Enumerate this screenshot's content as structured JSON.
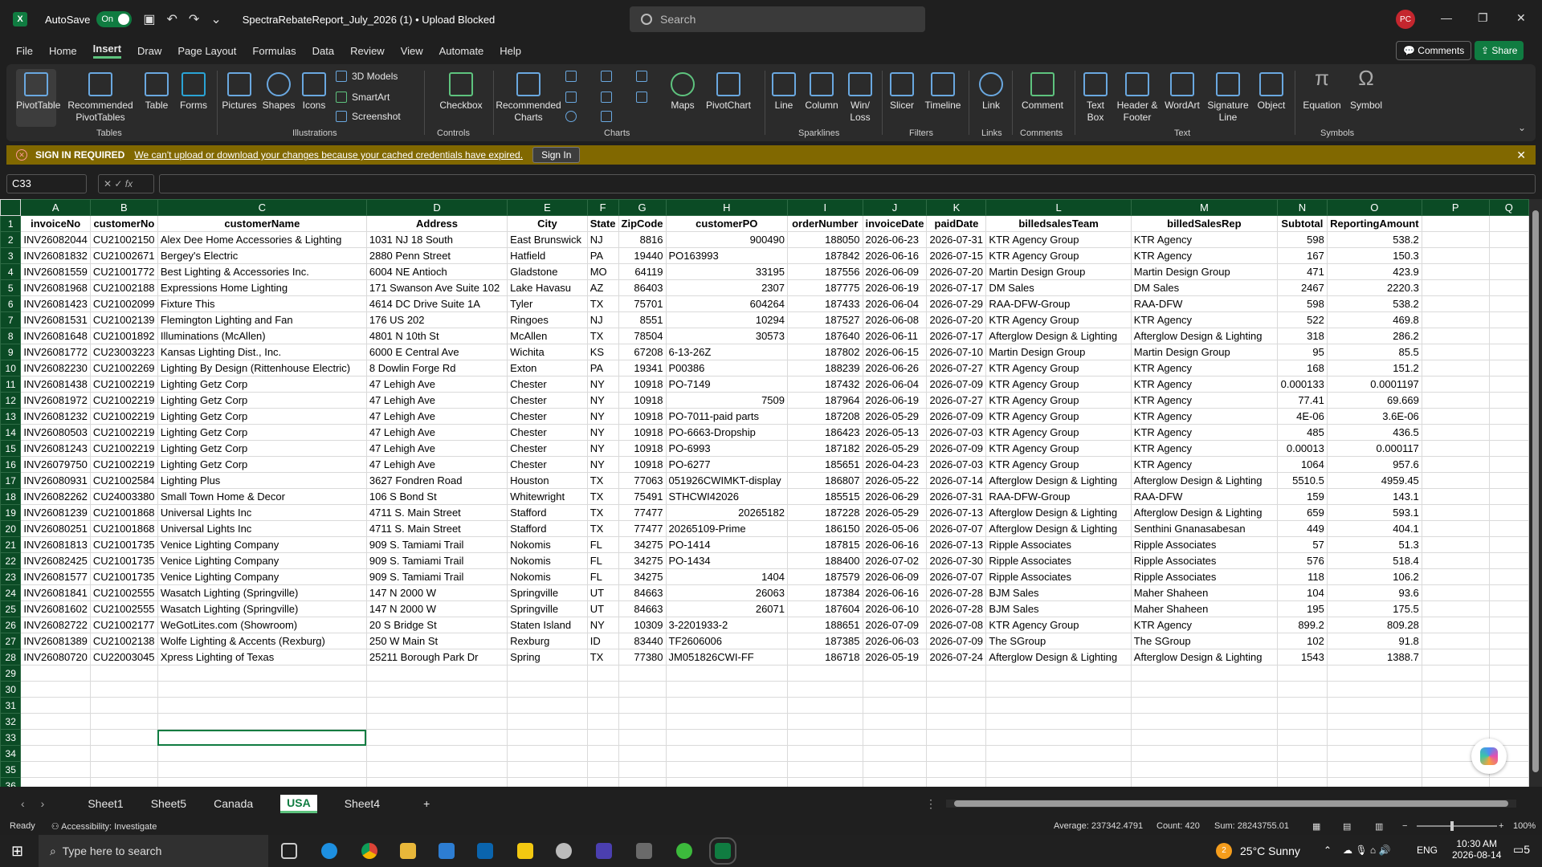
{
  "titlebar": {
    "autosave_label": "AutoSave",
    "autosave_state": "On",
    "doc_title": "SpectraRebateReport_July_2026 (1) • Upload Blocked",
    "search_placeholder": "Search",
    "avatar_initials": "PC"
  },
  "menu": {
    "items": [
      "File",
      "Home",
      "Insert",
      "Draw",
      "Page Layout",
      "Formulas",
      "Data",
      "Review",
      "View",
      "Automate",
      "Help"
    ],
    "active": "Insert",
    "comments_label": "Comments",
    "share_label": "Share"
  },
  "ribbon": {
    "pivottable": "PivotTable",
    "recommended_pivottables": "Recommended PivotTables",
    "table": "Table",
    "forms": "Forms",
    "pictures": "Pictures",
    "shapes": "Shapes",
    "icons": "Icons",
    "models3d": "3D Models",
    "smartart": "SmartArt",
    "screenshot": "Screenshot",
    "checkbox": "Checkbox",
    "recommended_charts": "Recommended Charts",
    "maps": "Maps",
    "pivotchart": "PivotChart",
    "line": "Line",
    "column": "Column",
    "winloss": "Win/ Loss",
    "slicer": "Slicer",
    "timeline": "Timeline",
    "link": "Link",
    "comment": "Comment",
    "textbox": "Text Box",
    "header_footer": "Header & Footer",
    "wordart": "WordArt",
    "signature_line": "Signature Line",
    "object": "Object",
    "equation": "Equation",
    "symbol": "Symbol",
    "groups": {
      "tables": "Tables",
      "illustrations": "Illustrations",
      "controls": "Controls",
      "charts": "Charts",
      "sparklines": "Sparklines",
      "filters": "Filters",
      "links": "Links",
      "comments": "Comments",
      "text": "Text",
      "symbols": "Symbols"
    }
  },
  "infobar": {
    "title": "SIGN IN REQUIRED",
    "message": "We can't upload or download your changes because your cached credentials have expired.",
    "button": "Sign In"
  },
  "formula_bar": {
    "name_box": "C33",
    "fx": "fx",
    "value": ""
  },
  "grid": {
    "columns": [
      "A",
      "B",
      "C",
      "D",
      "E",
      "F",
      "G",
      "H",
      "I",
      "J",
      "K",
      "L",
      "M",
      "N",
      "O",
      "P",
      "Q"
    ],
    "headers": [
      "invoiceNo",
      "customerNo",
      "customerName",
      "Address",
      "City",
      "State",
      "ZipCode",
      "customerPO",
      "orderNumber",
      "invoiceDate",
      "paidDate",
      "billedsalesTeam",
      "billedSalesRep",
      "Subtotal",
      "ReportingAmount",
      "",
      ""
    ],
    "rows": [
      [
        "INV26082044",
        "CU21002150",
        "Alex Dee Home Accessories & Lighting",
        "1031 NJ 18 South",
        "East Brunswick",
        "NJ",
        "8816",
        "900490",
        "188050",
        "2026-06-23",
        "2026-07-31",
        "KTR Agency Group",
        "KTR Agency",
        "598",
        "538.2"
      ],
      [
        "INV26081832",
        "CU21002671",
        "Bergey's Electric",
        "2880 Penn Street",
        "Hatfield",
        "PA",
        "19440",
        "PO163993",
        "187842",
        "2026-06-16",
        "2026-07-15",
        "KTR Agency Group",
        "KTR Agency",
        "167",
        "150.3"
      ],
      [
        "INV26081559",
        "CU21001772",
        "Best Lighting & Accessories Inc.",
        "6004 NE Antioch",
        "Gladstone",
        "MO",
        "64119",
        "33195",
        "187556",
        "2026-06-09",
        "2026-07-20",
        "Martin Design Group",
        "Martin Design Group",
        "471",
        "423.9"
      ],
      [
        "INV26081968",
        "CU21002188",
        "Expressions Home Lighting",
        "171 Swanson Ave Suite 102",
        "Lake Havasu",
        "AZ",
        "86403",
        "2307",
        "187775",
        "2026-06-19",
        "2026-07-17",
        "DM Sales",
        "DM Sales",
        "2467",
        "2220.3"
      ],
      [
        "INV26081423",
        "CU21002099",
        "Fixture This",
        "4614 DC Drive Suite 1A",
        "Tyler",
        "TX",
        "75701",
        "604264",
        "187433",
        "2026-06-04",
        "2026-07-29",
        "RAA-DFW-Group",
        "RAA-DFW",
        "598",
        "538.2"
      ],
      [
        "INV26081531",
        "CU21002139",
        "Flemington Lighting and Fan",
        "176 US 202",
        "Ringoes",
        "NJ",
        "8551",
        "10294",
        "187527",
        "2026-06-08",
        "2026-07-20",
        "KTR Agency Group",
        "KTR Agency",
        "522",
        "469.8"
      ],
      [
        "INV26081648",
        "CU21001892",
        "Illuminations (McAllen)",
        "4801 N 10th St",
        "McAllen",
        "TX",
        "78504",
        "30573",
        "187640",
        "2026-06-11",
        "2026-07-17",
        "Afterglow Design & Lighting",
        "Afterglow Design & Lighting",
        "318",
        "286.2"
      ],
      [
        "INV26081772",
        "CU23003223",
        "Kansas Lighting Dist., Inc.",
        "6000 E Central Ave",
        "Wichita",
        "KS",
        "67208",
        "6-13-26Z",
        "187802",
        "2026-06-15",
        "2026-07-10",
        "Martin Design Group",
        "Martin Design Group",
        "95",
        "85.5"
      ],
      [
        "INV26082230",
        "CU21002269",
        "Lighting By Design (Rittenhouse Electric)",
        "8 Dowlin Forge Rd",
        "Exton",
        "PA",
        "19341",
        "P00386",
        "188239",
        "2026-06-26",
        "2026-07-27",
        "KTR Agency Group",
        "KTR Agency",
        "168",
        "151.2"
      ],
      [
        "INV26081438",
        "CU21002219",
        "Lighting Getz Corp",
        "47 Lehigh Ave",
        "Chester",
        "NY",
        "10918",
        "PO-7149",
        "187432",
        "2026-06-04",
        "2026-07-09",
        "KTR Agency Group",
        "KTR Agency",
        "0.000133",
        "0.0001197"
      ],
      [
        "INV26081972",
        "CU21002219",
        "Lighting Getz Corp",
        "47 Lehigh Ave",
        "Chester",
        "NY",
        "10918",
        "7509",
        "187964",
        "2026-06-19",
        "2026-07-27",
        "KTR Agency Group",
        "KTR Agency",
        "77.41",
        "69.669"
      ],
      [
        "INV26081232",
        "CU21002219",
        "Lighting Getz Corp",
        "47 Lehigh Ave",
        "Chester",
        "NY",
        "10918",
        "PO-7011-paid parts",
        "187208",
        "2026-05-29",
        "2026-07-09",
        "KTR Agency Group",
        "KTR Agency",
        "4E-06",
        "3.6E-06"
      ],
      [
        "INV26080503",
        "CU21002219",
        "Lighting Getz Corp",
        "47 Lehigh Ave",
        "Chester",
        "NY",
        "10918",
        "PO-6663-Dropship",
        "186423",
        "2026-05-13",
        "2026-07-03",
        "KTR Agency Group",
        "KTR Agency",
        "485",
        "436.5"
      ],
      [
        "INV26081243",
        "CU21002219",
        "Lighting Getz Corp",
        "47 Lehigh Ave",
        "Chester",
        "NY",
        "10918",
        "PO-6993",
        "187182",
        "2026-05-29",
        "2026-07-09",
        "KTR Agency Group",
        "KTR Agency",
        "0.00013",
        "0.000117"
      ],
      [
        "INV26079750",
        "CU21002219",
        "Lighting Getz Corp",
        "47 Lehigh Ave",
        "Chester",
        "NY",
        "10918",
        "PO-6277",
        "185651",
        "2026-04-23",
        "2026-07-03",
        "KTR Agency Group",
        "KTR Agency",
        "1064",
        "957.6"
      ],
      [
        "INV26080931",
        "CU21002584",
        "Lighting Plus",
        "3627 Fondren Road",
        "Houston",
        "TX",
        "77063",
        "051926CWIMKT-display",
        "186807",
        "2026-05-22",
        "2026-07-14",
        "Afterglow Design & Lighting",
        "Afterglow Design & Lighting",
        "5510.5",
        "4959.45"
      ],
      [
        "INV26082262",
        "CU24003380",
        "Small Town Home & Decor",
        "106 S Bond St",
        "Whitewright",
        "TX",
        "75491",
        "STHCWI42026",
        "185515",
        "2026-06-29",
        "2026-07-31",
        "RAA-DFW-Group",
        "RAA-DFW",
        "159",
        "143.1"
      ],
      [
        "INV26081239",
        "CU21001868",
        "Universal Lights Inc",
        "4711 S. Main Street",
        "Stafford",
        "TX",
        "77477",
        "20265182",
        "187228",
        "2026-05-29",
        "2026-07-13",
        "Afterglow Design & Lighting",
        "Afterglow Design & Lighting",
        "659",
        "593.1"
      ],
      [
        "INV26080251",
        "CU21001868",
        "Universal Lights Inc",
        "4711 S. Main Street",
        "Stafford",
        "TX",
        "77477",
        "20265109-Prime",
        "186150",
        "2026-05-06",
        "2026-07-07",
        "Afterglow Design & Lighting",
        "Senthini Gnanasabesan",
        "449",
        "404.1"
      ],
      [
        "INV26081813",
        "CU21001735",
        "Venice Lighting Company",
        "909 S. Tamiami Trail",
        "Nokomis",
        "FL",
        "34275",
        "PO-1414",
        "187815",
        "2026-06-16",
        "2026-07-13",
        "Ripple Associates",
        "Ripple Associates",
        "57",
        "51.3"
      ],
      [
        "INV26082425",
        "CU21001735",
        "Venice Lighting Company",
        "909 S. Tamiami Trail",
        "Nokomis",
        "FL",
        "34275",
        "PO-1434",
        "188400",
        "2026-07-02",
        "2026-07-30",
        "Ripple Associates",
        "Ripple Associates",
        "576",
        "518.4"
      ],
      [
        "INV26081577",
        "CU21001735",
        "Venice Lighting Company",
        "909 S. Tamiami Trail",
        "Nokomis",
        "FL",
        "34275",
        "1404",
        "187579",
        "2026-06-09",
        "2026-07-07",
        "Ripple Associates",
        "Ripple Associates",
        "118",
        "106.2"
      ],
      [
        "INV26081841",
        "CU21002555",
        "Wasatch Lighting (Springville)",
        "147 N 2000 W",
        "Springville",
        "UT",
        "84663",
        "26063",
        "187384",
        "2026-06-16",
        "2026-07-28",
        "BJM Sales",
        "Maher Shaheen",
        "104",
        "93.6"
      ],
      [
        "INV26081602",
        "CU21002555",
        "Wasatch Lighting (Springville)",
        "147 N 2000 W",
        "Springville",
        "UT",
        "84663",
        "26071",
        "187604",
        "2026-06-10",
        "2026-07-28",
        "BJM Sales",
        "Maher Shaheen",
        "195",
        "175.5"
      ],
      [
        "INV26082722",
        "CU21002177",
        "WeGotLites.com (Showroom)",
        "20 S Bridge St",
        "Staten Island",
        "NY",
        "10309",
        "3-2201933-2",
        "188651",
        "2026-07-09",
        "2026-07-08",
        "KTR Agency Group",
        "KTR Agency",
        "899.2",
        "809.28"
      ],
      [
        "INV26081389",
        "CU21002138",
        "Wolfe Lighting & Accents (Rexburg)",
        "250 W Main St",
        "Rexburg",
        "ID",
        "83440",
        "TF2606006",
        "187385",
        "2026-06-03",
        "2026-07-09",
        "The SGroup",
        "The SGroup",
        "102",
        "91.8"
      ],
      [
        "INV26080720",
        "CU22003045",
        "Xpress Lighting of Texas",
        "25211 Borough Park Dr",
        "Spring",
        "TX",
        "77380",
        "JM051826CWI-FF",
        "186718",
        "2026-05-19",
        "2026-07-24",
        "Afterglow Design & Lighting",
        "Afterglow Design & Lighting",
        "1543",
        "1388.7"
      ]
    ],
    "empty_rows": [
      29,
      30,
      31,
      32,
      33,
      34,
      35,
      36
    ]
  },
  "sheets": {
    "tabs": [
      "Sheet1",
      "Sheet5",
      "Canada",
      "USA",
      "Sheet4"
    ],
    "active": "USA",
    "add": "+"
  },
  "status": {
    "ready": "Ready",
    "accessibility": "Accessibility: Investigate",
    "average": "Average: 237342.4791",
    "count": "Count: 420",
    "sum": "Sum: 28243755.01",
    "zoom": "100%"
  },
  "taskbar": {
    "search_placeholder": "Type here to search",
    "weather": "25°C  Sunny",
    "weather_badge": "2",
    "lang": "ENG",
    "time": "10:30 AM",
    "date": "2026-08-14",
    "notif_count": "5"
  },
  "colors": {
    "excel_green": "#107c41",
    "header_green": "#0b4b25",
    "infobar": "#816800"
  }
}
